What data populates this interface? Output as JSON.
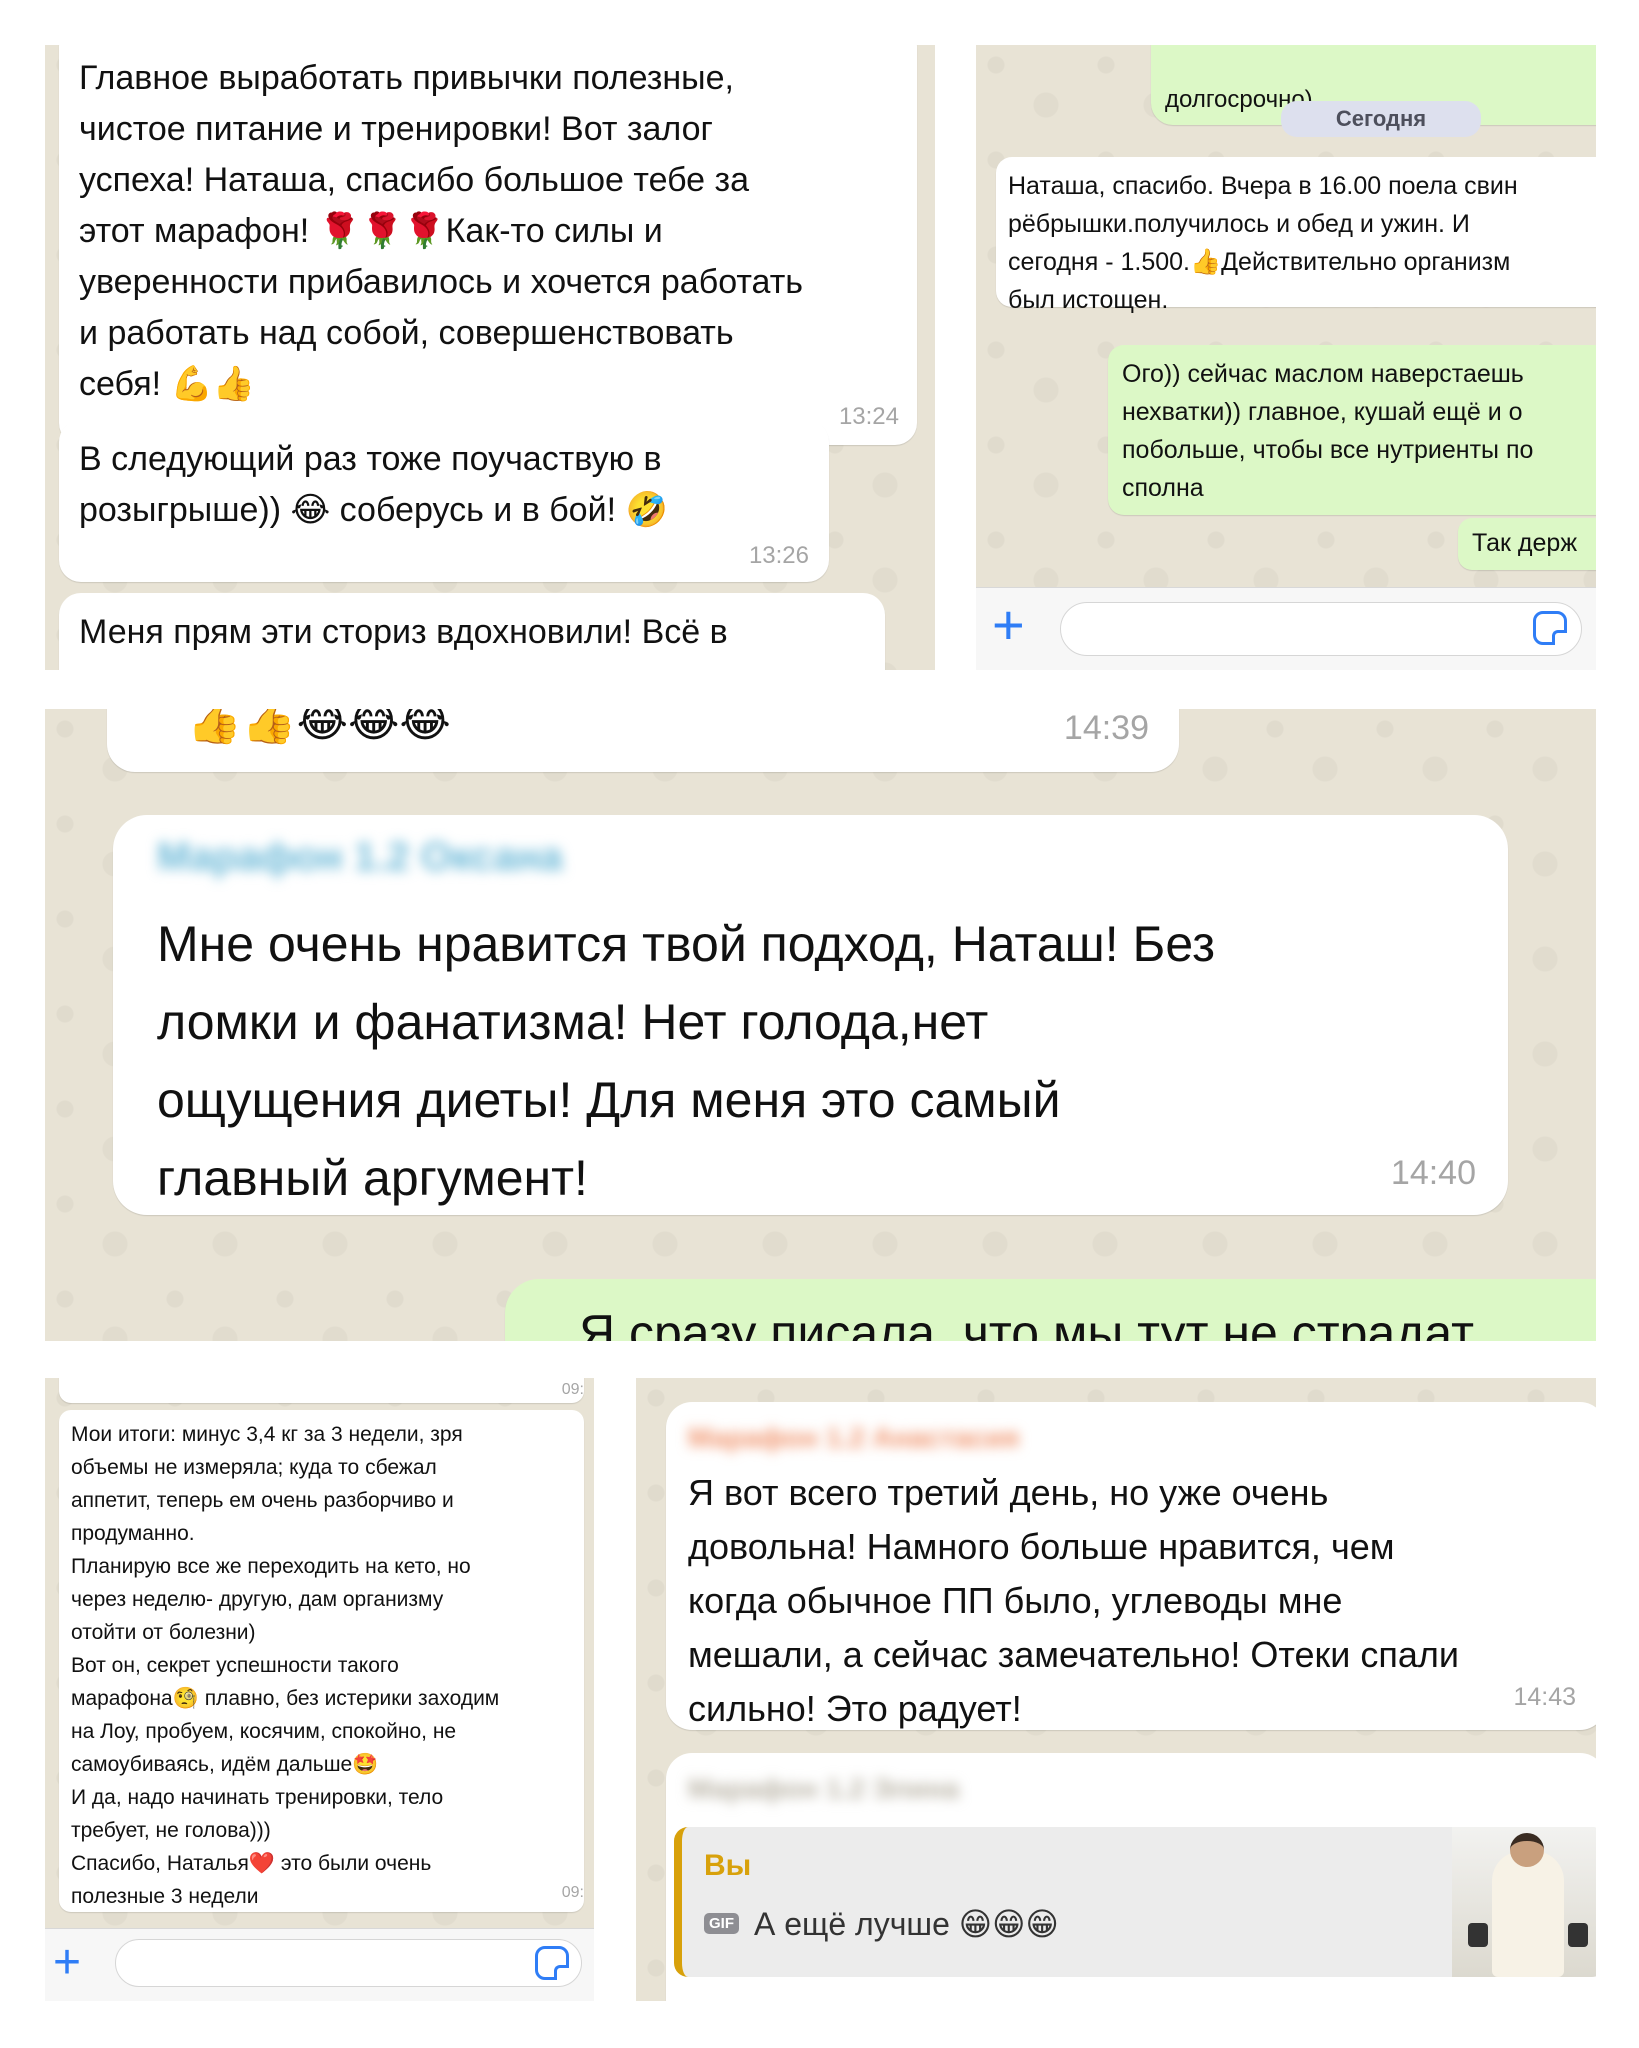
{
  "panel1": {
    "msg1": {
      "text": "Главное выработать привычки полезные,\nчистое питание и тренировки! Вот залог\nуспеха! Наташа, спасибо большое тебе за\nэтот марафон! 🌹🌹🌹Как-то силы и\nуверенности прибавилось и хочется работать\nи работать над собой, совершенствовать\nсебя! 💪👍",
      "time": "13:24"
    },
    "msg2": {
      "text": "В следующий раз тоже поучаствую в\nрозыгрыше)) 😂 соберусь и в бой! 🤣",
      "time": "13:26"
    },
    "msg3": {
      "text": "Меня прям эти сториз вдохновили! Всё в"
    }
  },
  "panel2": {
    "top_bubble": "долгосрочно)",
    "date_pill": "Сегодня",
    "msg_in": "Наташа, спасибо. Вчера в 16.00 поела свин\nрёбрышки.получилось и обед и ужин. И\nсегодня - 1.500.👍Действительно организм\nбыл истощен.",
    "msg_out": "Ого)) сейчас маслом наверстаешь\nнехватки)) главное, кушай ещё и о\nпобольше, чтобы все нутриенты по\nсполна",
    "msg_out2": "Так держ",
    "plus_icon": "+"
  },
  "panel3": {
    "top_emojis": "👍👍😂😂😂",
    "top_time": "14:39",
    "sender": "Марафон 1.2 Оксана",
    "text": "Мне очень нравится твой подход, Наташ! Без\nломки и фанатизма! Нет голода,нет\nощущения диеты! Для меня это самый\nглавный аргумент!",
    "time": "14:40",
    "out_partial": "Я сразу писала, что мы тут не страдат"
  },
  "panel4": {
    "top_time": "09:",
    "text": "Мои итоги: минус 3,4 кг за 3 недели, зря\nобъемы не измеряла; куда то сбежал\nаппетит, теперь ем очень разборчиво и\nпродуманно.\nПланирую все же переходить на кето, но\nчерез неделю- другую, дам организму\nотойти от болезни)\nВот он, секрет успешности такого\nмарафона🧐 плавно, без истерики заходим\nна Лоу, пробуем, косячим, спокойно, не\nсамоубиваясь, идём дальше🤩\nИ да, надо начинать тренировки, тело\nтребует, не голова)))\nСпасибо, Наталья❤️ это были очень\nполезные 3 недели",
    "time": "09:",
    "plus_icon": "+"
  },
  "panel5": {
    "sender1": "Марафон 1.2 Анастасия",
    "text": "Я вот всего третий день, но уже очень\nдовольна! Намного больше нравится, чем\nкогда обычное ПП было, углеводы мне\nмешали, а сейчас замечательно! Отеки спали\nсильно! Это радует!",
    "time": "14:43",
    "sender2": "Марафон 1.2 Элина",
    "reply_author": "Вы",
    "gif_badge": "GIF",
    "reply_text": "А ещё лучше 😁😁😁"
  },
  "colors": {
    "bubble_in": "#ffffff",
    "bubble_out": "#dcf8c6",
    "accent": "#2f7df6",
    "reply_bar": "#d8a10b"
  }
}
